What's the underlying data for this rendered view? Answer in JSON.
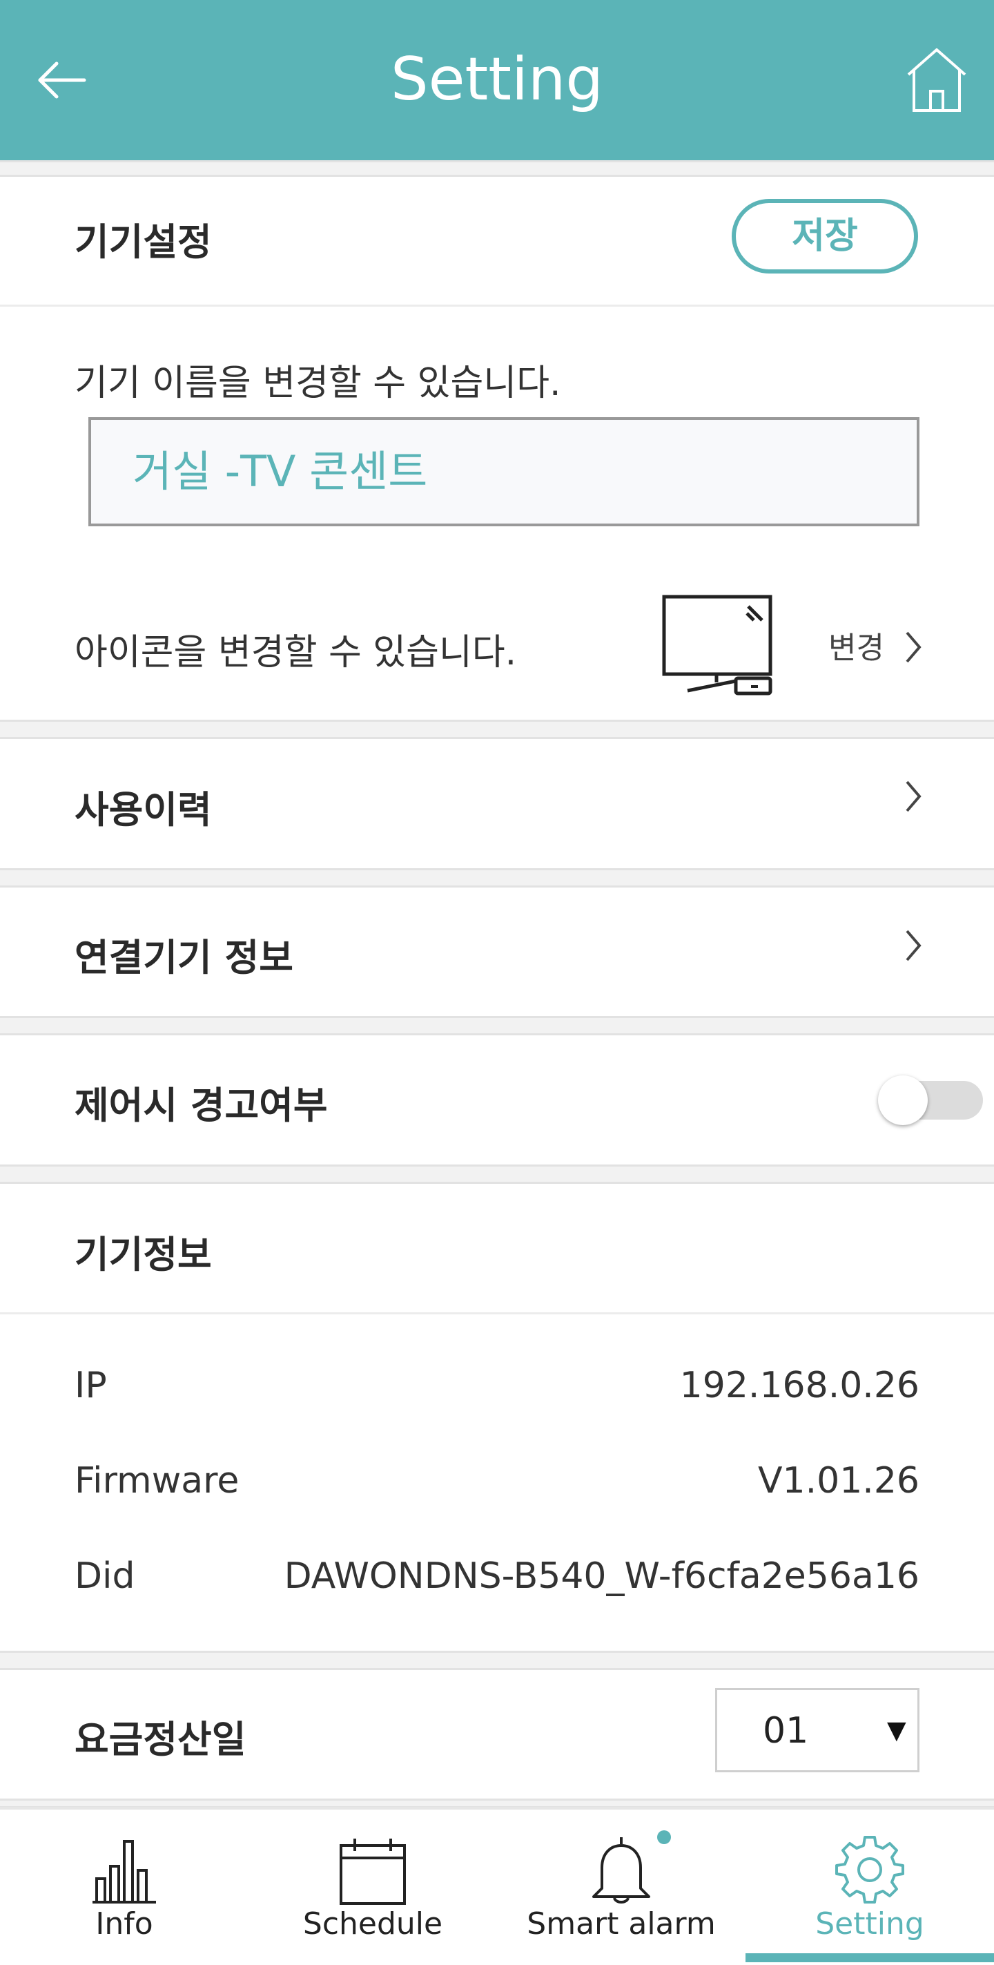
{
  "header": {
    "title": "Setting"
  },
  "device_settings": {
    "title": "기기설정",
    "save_label": "저장",
    "name_hint": "기기 이름을 변경할 수 있습니다.",
    "name_value": "거실 -TV 콘센트",
    "icon_hint": "아이콘을 변경할 수 있습니다.",
    "change_label": "변경"
  },
  "usage_history": {
    "title": "사용이력"
  },
  "connected_device_info": {
    "title": "연결기기 정보"
  },
  "control_warning": {
    "title": "제어시 경고여부",
    "enabled": false
  },
  "device_info": {
    "title": "기기정보",
    "rows": [
      {
        "key": "IP",
        "value": "192.168.0.26"
      },
      {
        "key": "Firmware",
        "value": "V1.01.26"
      },
      {
        "key": "Did",
        "value": "DAWONDNS-B540_W-f6cfa2e56a16"
      }
    ]
  },
  "billing_day": {
    "title": "요금정산일",
    "selected": "01"
  },
  "bottom_nav": {
    "items": [
      {
        "label": "Info",
        "icon": "bar-chart-icon"
      },
      {
        "label": "Schedule",
        "icon": "calendar-icon"
      },
      {
        "label": "Smart alarm",
        "icon": "bell-icon"
      },
      {
        "label": "Setting",
        "icon": "gear-icon",
        "active": true
      }
    ]
  },
  "colors": {
    "accent": "#5bb4b7"
  }
}
